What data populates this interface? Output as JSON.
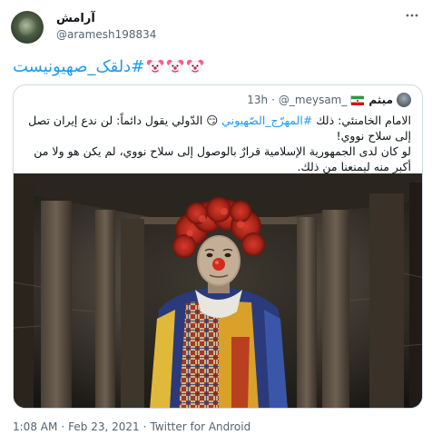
{
  "author": {
    "display_name": "آرامش",
    "handle": "@aramesh198834"
  },
  "tweet": {
    "hashtag_text": "#دلقک_صهیونیست",
    "emoji": [
      "clown-face",
      "clown-face",
      "clown-face"
    ]
  },
  "quoted": {
    "display_name": "میثم",
    "handle": "@_meysam_",
    "separator": "·",
    "time": "13h",
    "flag": "iran-flag",
    "line1_before": "الامام الخامنئي: ذلك ",
    "line1_hashtag": "#المهرّج_الصّهيوني",
    "line1_after": " 😏 الدّولي يقول دائماً: لن ندع إيران تصل إلى سلاح نووي!",
    "line2": "لو كان لدى الجمهورية الإسلامية قرارٌ بالوصول إلى سلاح نووي، لم يكن هو ولا من أكبر منه ليمنعنا من ذلك."
  },
  "footer": {
    "time": "1:08 AM",
    "separator": "·",
    "date": "Feb 23, 2021",
    "separator2": "·",
    "source": "Twitter for Android"
  },
  "colors": {
    "link": "#1d9bf0",
    "muted": "#536471",
    "border": "#cfd9de"
  }
}
